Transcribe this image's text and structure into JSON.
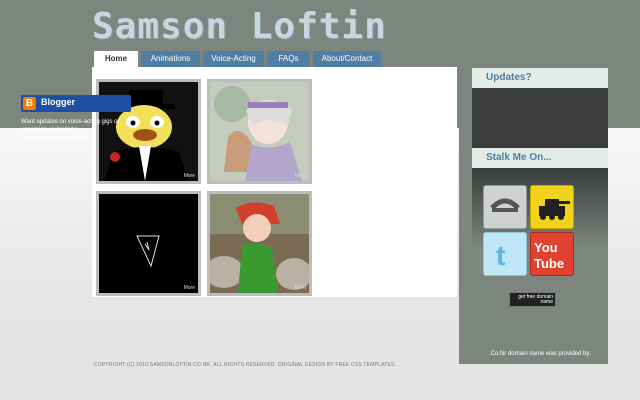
{
  "site": {
    "title": "Samson Loftin"
  },
  "nav": {
    "items": [
      {
        "label": "Home",
        "active": true
      },
      {
        "label": "Animations"
      },
      {
        "label": "Voice-Acting"
      },
      {
        "label": "FAQs"
      },
      {
        "label": "About/Contact"
      }
    ]
  },
  "gallery": {
    "items": [
      {
        "more": "More",
        "subject": "penguin-tophat"
      },
      {
        "more": "More",
        "subject": "warrior-girl"
      },
      {
        "more": "More",
        "subject": "dark-sketch"
      },
      {
        "more": "More",
        "subject": "elf-girl"
      }
    ]
  },
  "footer": {
    "text": "COPYRIGHT (C) 2010 SAMSONLOFTIN.CO.NR. ALL RIGHTS RESERVED. ORIGINAL DESIGN BY FREE CSS TEMPLATES."
  },
  "sidebar": {
    "updates_title": "Updates?",
    "blogger_label": "Blogger",
    "updates_text_1": "Want updates on voice-acting gigs or upcoming animations,",
    "updates_text_2": "Check out my Blogger site.",
    "stalk_title": "Stalk Me On...",
    "social": [
      {
        "label": "dA",
        "name": "deviantart"
      },
      {
        "label": "tank",
        "name": "newgrounds"
      },
      {
        "label": "t",
        "name": "twitter"
      },
      {
        "label": "You Tube",
        "name": "youtube"
      }
    ],
    "domain_text": ".Co.Nr domain name was provided by:",
    "domain_badge": "get free domain name"
  },
  "colors": {
    "nav": "#4f7ea4",
    "header_band": "#7c857e",
    "accent": "#4f7ea4"
  }
}
